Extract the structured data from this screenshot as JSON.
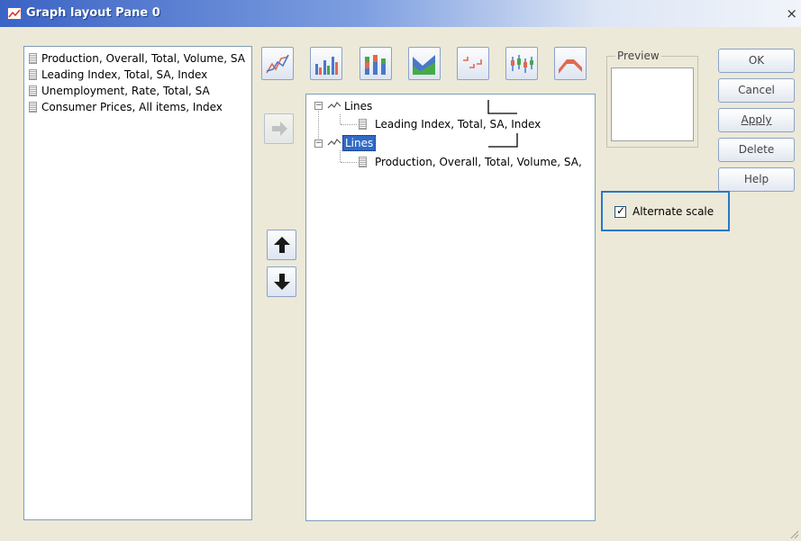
{
  "window": {
    "title": "Graph layout Pane 0",
    "close_label": "×"
  },
  "source_list": {
    "items": [
      "Production, Overall, Total, Volume, SA",
      "Leading Index, Total, SA, Index",
      "Unemployment, Rate, Total, SA",
      "Consumer Prices, All items, Index"
    ]
  },
  "toolbar": {
    "chart_types": [
      {
        "icon": "line-chart-icon"
      },
      {
        "icon": "bar-chart-icon"
      },
      {
        "icon": "stacked-bar-chart-icon"
      },
      {
        "icon": "area-chart-icon"
      },
      {
        "icon": "step-chart-icon"
      },
      {
        "icon": "high-low-chart-icon"
      },
      {
        "icon": "band-chart-icon"
      }
    ],
    "colors": {
      "accent_blue": "#4a78c8",
      "accent_red": "#e0694f",
      "accent_green": "#46a84a"
    }
  },
  "tree": {
    "groups": [
      {
        "label": "Lines",
        "expander": "−",
        "child": "Leading Index, Total, SA, Index",
        "selected": false
      },
      {
        "label": "Lines",
        "expander": "−",
        "child": "Production, Overall, Total, Volume, SA,",
        "selected": true
      }
    ]
  },
  "preview": {
    "label": "Preview"
  },
  "buttons": {
    "ok": "OK",
    "cancel": "Cancel",
    "apply": "Apply",
    "delete": "Delete",
    "help": "Help"
  },
  "alternate_scale": {
    "label": "Alternate scale",
    "checked": true,
    "check_glyph": "✓"
  },
  "colors": {
    "selection": "#316ac5",
    "focus_border": "#2a78c8"
  }
}
